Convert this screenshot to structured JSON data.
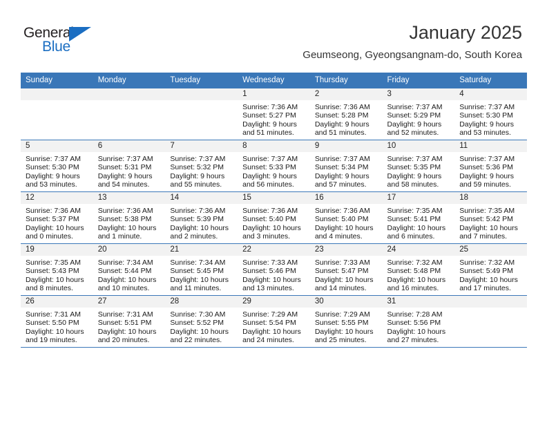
{
  "brand": {
    "name_part1": "General",
    "name_part2": "Blue",
    "triangle_color": "#1b6ec2"
  },
  "header": {
    "month_title": "January 2025",
    "location": "Geumseong, Gyeongsangnam-do, South Korea",
    "header_bg_color": "#3a77b8",
    "daynum_bg_color": "#f2f2f2"
  },
  "weekdays": [
    "Sunday",
    "Monday",
    "Tuesday",
    "Wednesday",
    "Thursday",
    "Friday",
    "Saturday"
  ],
  "weeks": [
    [
      {
        "day": "",
        "sunrise": "",
        "sunset": "",
        "daylight_line1": "",
        "daylight_line2": ""
      },
      {
        "day": "",
        "sunrise": "",
        "sunset": "",
        "daylight_line1": "",
        "daylight_line2": ""
      },
      {
        "day": "",
        "sunrise": "",
        "sunset": "",
        "daylight_line1": "",
        "daylight_line2": ""
      },
      {
        "day": "1",
        "sunrise": "Sunrise: 7:36 AM",
        "sunset": "Sunset: 5:27 PM",
        "daylight_line1": "Daylight: 9 hours",
        "daylight_line2": "and 51 minutes."
      },
      {
        "day": "2",
        "sunrise": "Sunrise: 7:36 AM",
        "sunset": "Sunset: 5:28 PM",
        "daylight_line1": "Daylight: 9 hours",
        "daylight_line2": "and 51 minutes."
      },
      {
        "day": "3",
        "sunrise": "Sunrise: 7:37 AM",
        "sunset": "Sunset: 5:29 PM",
        "daylight_line1": "Daylight: 9 hours",
        "daylight_line2": "and 52 minutes."
      },
      {
        "day": "4",
        "sunrise": "Sunrise: 7:37 AM",
        "sunset": "Sunset: 5:30 PM",
        "daylight_line1": "Daylight: 9 hours",
        "daylight_line2": "and 53 minutes."
      }
    ],
    [
      {
        "day": "5",
        "sunrise": "Sunrise: 7:37 AM",
        "sunset": "Sunset: 5:30 PM",
        "daylight_line1": "Daylight: 9 hours",
        "daylight_line2": "and 53 minutes."
      },
      {
        "day": "6",
        "sunrise": "Sunrise: 7:37 AM",
        "sunset": "Sunset: 5:31 PM",
        "daylight_line1": "Daylight: 9 hours",
        "daylight_line2": "and 54 minutes."
      },
      {
        "day": "7",
        "sunrise": "Sunrise: 7:37 AM",
        "sunset": "Sunset: 5:32 PM",
        "daylight_line1": "Daylight: 9 hours",
        "daylight_line2": "and 55 minutes."
      },
      {
        "day": "8",
        "sunrise": "Sunrise: 7:37 AM",
        "sunset": "Sunset: 5:33 PM",
        "daylight_line1": "Daylight: 9 hours",
        "daylight_line2": "and 56 minutes."
      },
      {
        "day": "9",
        "sunrise": "Sunrise: 7:37 AM",
        "sunset": "Sunset: 5:34 PM",
        "daylight_line1": "Daylight: 9 hours",
        "daylight_line2": "and 57 minutes."
      },
      {
        "day": "10",
        "sunrise": "Sunrise: 7:37 AM",
        "sunset": "Sunset: 5:35 PM",
        "daylight_line1": "Daylight: 9 hours",
        "daylight_line2": "and 58 minutes."
      },
      {
        "day": "11",
        "sunrise": "Sunrise: 7:37 AM",
        "sunset": "Sunset: 5:36 PM",
        "daylight_line1": "Daylight: 9 hours",
        "daylight_line2": "and 59 minutes."
      }
    ],
    [
      {
        "day": "12",
        "sunrise": "Sunrise: 7:36 AM",
        "sunset": "Sunset: 5:37 PM",
        "daylight_line1": "Daylight: 10 hours",
        "daylight_line2": "and 0 minutes."
      },
      {
        "day": "13",
        "sunrise": "Sunrise: 7:36 AM",
        "sunset": "Sunset: 5:38 PM",
        "daylight_line1": "Daylight: 10 hours",
        "daylight_line2": "and 1 minute."
      },
      {
        "day": "14",
        "sunrise": "Sunrise: 7:36 AM",
        "sunset": "Sunset: 5:39 PM",
        "daylight_line1": "Daylight: 10 hours",
        "daylight_line2": "and 2 minutes."
      },
      {
        "day": "15",
        "sunrise": "Sunrise: 7:36 AM",
        "sunset": "Sunset: 5:40 PM",
        "daylight_line1": "Daylight: 10 hours",
        "daylight_line2": "and 3 minutes."
      },
      {
        "day": "16",
        "sunrise": "Sunrise: 7:36 AM",
        "sunset": "Sunset: 5:40 PM",
        "daylight_line1": "Daylight: 10 hours",
        "daylight_line2": "and 4 minutes."
      },
      {
        "day": "17",
        "sunrise": "Sunrise: 7:35 AM",
        "sunset": "Sunset: 5:41 PM",
        "daylight_line1": "Daylight: 10 hours",
        "daylight_line2": "and 6 minutes."
      },
      {
        "day": "18",
        "sunrise": "Sunrise: 7:35 AM",
        "sunset": "Sunset: 5:42 PM",
        "daylight_line1": "Daylight: 10 hours",
        "daylight_line2": "and 7 minutes."
      }
    ],
    [
      {
        "day": "19",
        "sunrise": "Sunrise: 7:35 AM",
        "sunset": "Sunset: 5:43 PM",
        "daylight_line1": "Daylight: 10 hours",
        "daylight_line2": "and 8 minutes."
      },
      {
        "day": "20",
        "sunrise": "Sunrise: 7:34 AM",
        "sunset": "Sunset: 5:44 PM",
        "daylight_line1": "Daylight: 10 hours",
        "daylight_line2": "and 10 minutes."
      },
      {
        "day": "21",
        "sunrise": "Sunrise: 7:34 AM",
        "sunset": "Sunset: 5:45 PM",
        "daylight_line1": "Daylight: 10 hours",
        "daylight_line2": "and 11 minutes."
      },
      {
        "day": "22",
        "sunrise": "Sunrise: 7:33 AM",
        "sunset": "Sunset: 5:46 PM",
        "daylight_line1": "Daylight: 10 hours",
        "daylight_line2": "and 13 minutes."
      },
      {
        "day": "23",
        "sunrise": "Sunrise: 7:33 AM",
        "sunset": "Sunset: 5:47 PM",
        "daylight_line1": "Daylight: 10 hours",
        "daylight_line2": "and 14 minutes."
      },
      {
        "day": "24",
        "sunrise": "Sunrise: 7:32 AM",
        "sunset": "Sunset: 5:48 PM",
        "daylight_line1": "Daylight: 10 hours",
        "daylight_line2": "and 16 minutes."
      },
      {
        "day": "25",
        "sunrise": "Sunrise: 7:32 AM",
        "sunset": "Sunset: 5:49 PM",
        "daylight_line1": "Daylight: 10 hours",
        "daylight_line2": "and 17 minutes."
      }
    ],
    [
      {
        "day": "26",
        "sunrise": "Sunrise: 7:31 AM",
        "sunset": "Sunset: 5:50 PM",
        "daylight_line1": "Daylight: 10 hours",
        "daylight_line2": "and 19 minutes."
      },
      {
        "day": "27",
        "sunrise": "Sunrise: 7:31 AM",
        "sunset": "Sunset: 5:51 PM",
        "daylight_line1": "Daylight: 10 hours",
        "daylight_line2": "and 20 minutes."
      },
      {
        "day": "28",
        "sunrise": "Sunrise: 7:30 AM",
        "sunset": "Sunset: 5:52 PM",
        "daylight_line1": "Daylight: 10 hours",
        "daylight_line2": "and 22 minutes."
      },
      {
        "day": "29",
        "sunrise": "Sunrise: 7:29 AM",
        "sunset": "Sunset: 5:54 PM",
        "daylight_line1": "Daylight: 10 hours",
        "daylight_line2": "and 24 minutes."
      },
      {
        "day": "30",
        "sunrise": "Sunrise: 7:29 AM",
        "sunset": "Sunset: 5:55 PM",
        "daylight_line1": "Daylight: 10 hours",
        "daylight_line2": "and 25 minutes."
      },
      {
        "day": "31",
        "sunrise": "Sunrise: 7:28 AM",
        "sunset": "Sunset: 5:56 PM",
        "daylight_line1": "Daylight: 10 hours",
        "daylight_line2": "and 27 minutes."
      },
      {
        "day": "",
        "sunrise": "",
        "sunset": "",
        "daylight_line1": "",
        "daylight_line2": ""
      }
    ]
  ]
}
